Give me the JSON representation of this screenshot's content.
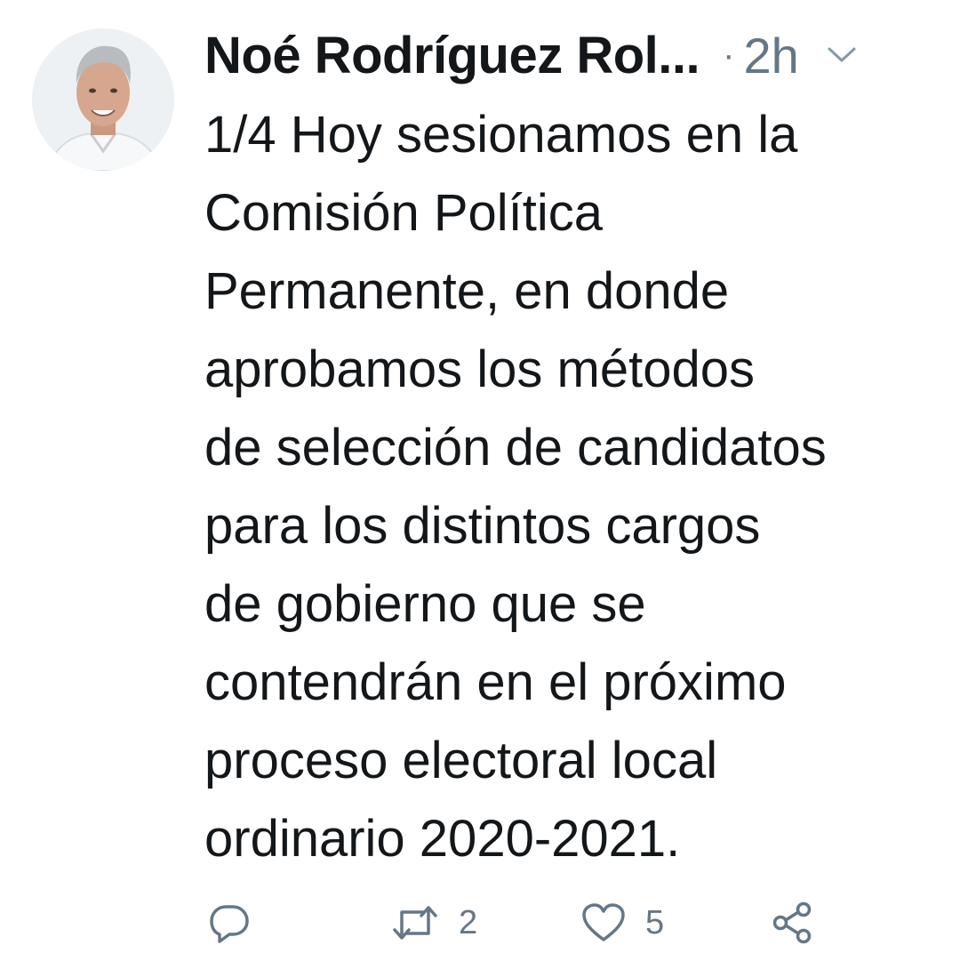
{
  "tweet": {
    "author": {
      "display_name": "Noé Rodríguez Rol...",
      "avatar_icon": "profile-photo"
    },
    "separator": "·",
    "timestamp": "2h",
    "menu_icon": "chevron-down-icon",
    "text_lines": [
      "1/4 Hoy sesionamos en la",
      "Comisión Política",
      "Permanente, en donde",
      "aprobamos los métodos",
      "de selección de candidatos",
      "para los distintos cargos",
      "de gobierno que se",
      "contendrán en el próximo",
      "proceso electoral local",
      "ordinario 2020-2021."
    ],
    "actions": {
      "reply": {
        "icon": "reply-icon",
        "count": ""
      },
      "retweet": {
        "icon": "retweet-icon",
        "count": "2"
      },
      "like": {
        "icon": "heart-icon",
        "count": "5"
      },
      "share": {
        "icon": "share-icon"
      }
    }
  },
  "colors": {
    "text": "#14171a",
    "secondary": "#657786",
    "background": "#ffffff"
  }
}
